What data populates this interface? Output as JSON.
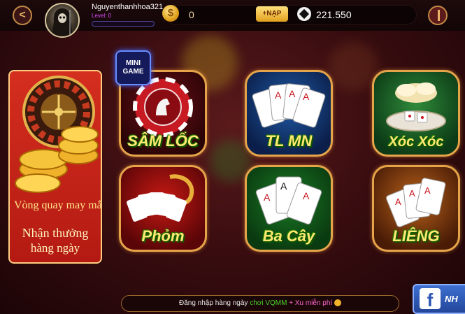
{
  "header": {
    "username": "Nguyenthanhhoa321",
    "level_label": "Level: 0",
    "coin_symbol": "$",
    "coin_balance": "0",
    "topup_label": "+NẠP",
    "diamond_balance": "221.550"
  },
  "banner": {
    "title": "Vòng quay may mắn",
    "subtitle_line1": "Nhận thưởng",
    "subtitle_line2": "hàng ngày"
  },
  "mini_game": {
    "line1": "MINI",
    "line2": "GAME"
  },
  "games": [
    {
      "label": "SÂM LỐC"
    },
    {
      "label": "TL MN"
    },
    {
      "label": "Xóc Xóc"
    },
    {
      "label": "Phỏm"
    },
    {
      "label": "Ba Cây"
    },
    {
      "label": "LIÊNG"
    }
  ],
  "marquee": {
    "part1": "Đăng nhập hàng ngày",
    "part2": "chơi VQMM",
    "part3": "+ Xu miễn phí"
  },
  "facebook": {
    "icon_letter": "f",
    "label": "NH"
  },
  "colors": {
    "accent_gold": "#e6a44a",
    "label_yellow": "#ffe873",
    "banner_red": "#c8261a"
  }
}
